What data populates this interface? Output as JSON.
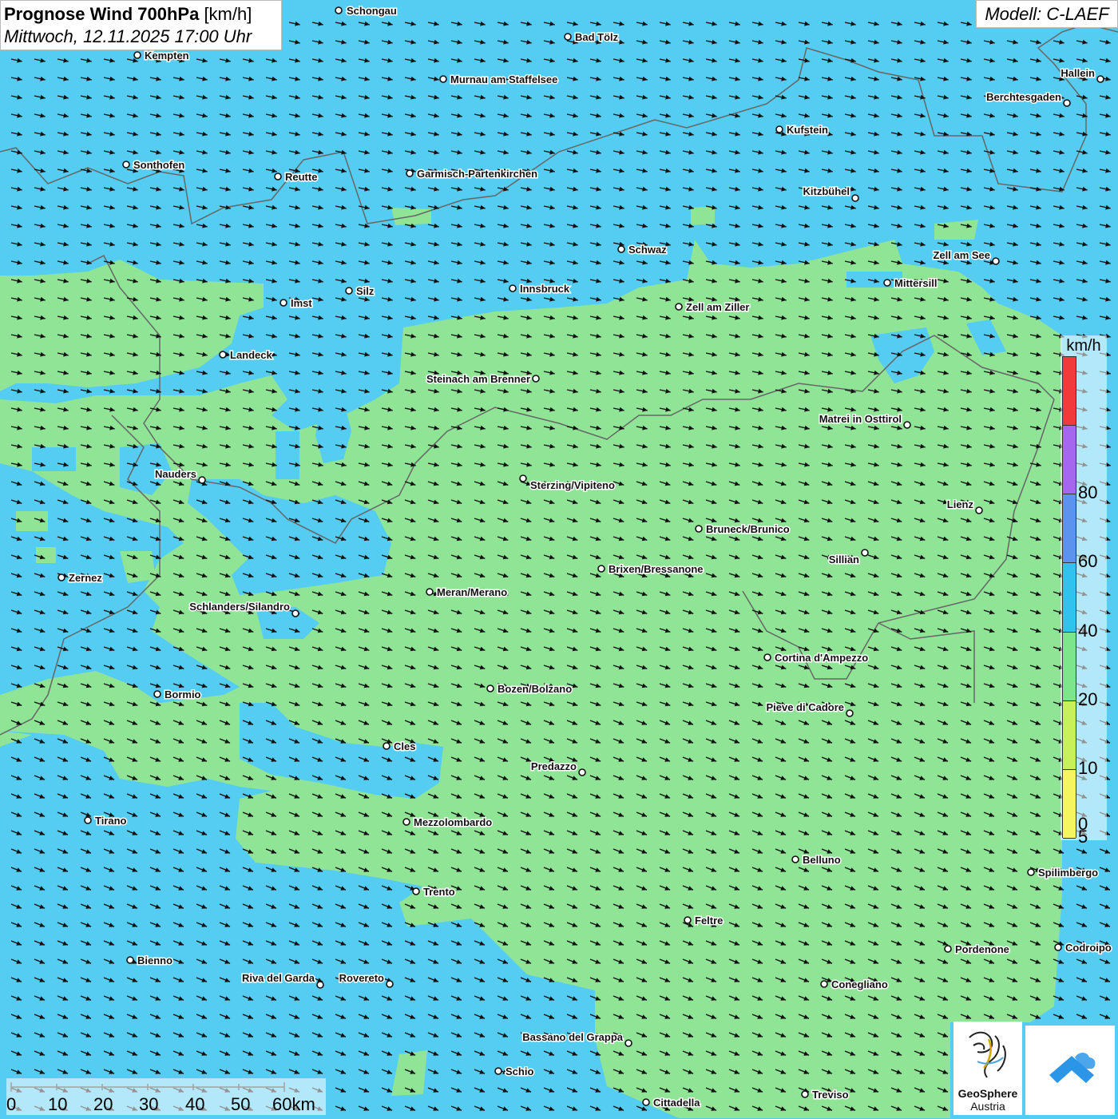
{
  "header": {
    "title_bold": "Prognose Wind 700hPa",
    "title_unit": "[km/h]",
    "subtitle": "Mittwoch, 12.11.2025 17:00 Uhr",
    "model": "Modell: C-LAEF"
  },
  "legend": {
    "unit": "km/h",
    "classes": [
      {
        "label": "",
        "color": "#f23a3a"
      },
      {
        "label": "80",
        "color": "#a766ee"
      },
      {
        "label": "60",
        "color": "#5c93ee"
      },
      {
        "label": "40",
        "color": "#31c2ee"
      },
      {
        "label": "20",
        "color": "#7de68b"
      },
      {
        "label": "10",
        "color": "#c8f05b"
      },
      {
        "label": "5",
        "color": "#f5f561"
      }
    ],
    "bottom_label": "0"
  },
  "scalebar": {
    "labels": [
      "0",
      "10",
      "20",
      "30",
      "40",
      "50",
      "60km"
    ]
  },
  "logo": {
    "geosphere_line1": "GeoSphere",
    "geosphere_line2": "Austria"
  },
  "colors": {
    "sea_blue": "#55ccf2",
    "land_green": "#8fe496",
    "arrow": "#111111"
  },
  "cities": [
    {
      "name": "Schongau"
    },
    {
      "name": "Bad Tölz"
    },
    {
      "name": "Kempten"
    },
    {
      "name": "Murnau am Staffelsee"
    },
    {
      "name": "Hallein"
    },
    {
      "name": "Berchtesgaden"
    },
    {
      "name": "Kufstein"
    },
    {
      "name": "Sonthofen"
    },
    {
      "name": "Reutte"
    },
    {
      "name": "Garmisch-Partenkirchen"
    },
    {
      "name": "Kitzbühel"
    },
    {
      "name": "Schwaz"
    },
    {
      "name": "Zell am See"
    },
    {
      "name": "Mittersill"
    },
    {
      "name": "Innsbruck"
    },
    {
      "name": "Imst"
    },
    {
      "name": "Silz"
    },
    {
      "name": "Zell am Ziller"
    },
    {
      "name": "Landeck"
    },
    {
      "name": "Steinach am Brenner"
    },
    {
      "name": "Matrei in Osttirol"
    },
    {
      "name": "Nauders"
    },
    {
      "name": "Sterzing/Vipiteno"
    },
    {
      "name": "Lienz"
    },
    {
      "name": "Bruneck/Brunico"
    },
    {
      "name": "Sillian"
    },
    {
      "name": "Zernez"
    },
    {
      "name": "Brixen/Bressanone"
    },
    {
      "name": "Meran/Merano"
    },
    {
      "name": "Schlanders/Silandro"
    },
    {
      "name": "Cortina d'Ampezzo"
    },
    {
      "name": "Bozen/Bolzano"
    },
    {
      "name": "Bormio"
    },
    {
      "name": "Pieve di Cadore"
    },
    {
      "name": "Cles"
    },
    {
      "name": "Predazzo"
    },
    {
      "name": "Tirano"
    },
    {
      "name": "Mezzolombardo"
    },
    {
      "name": "Belluno"
    },
    {
      "name": "Spilimbergo"
    },
    {
      "name": "Trento"
    },
    {
      "name": "Feltre"
    },
    {
      "name": "Pordenone"
    },
    {
      "name": "Codroipo"
    },
    {
      "name": "Bienno"
    },
    {
      "name": "Riva del Garda"
    },
    {
      "name": "Rovereto"
    },
    {
      "name": "Conegliano"
    },
    {
      "name": "Bassano del Grappa"
    },
    {
      "name": "Schio"
    },
    {
      "name": "Treviso"
    },
    {
      "name": "Cittadella"
    }
  ]
}
